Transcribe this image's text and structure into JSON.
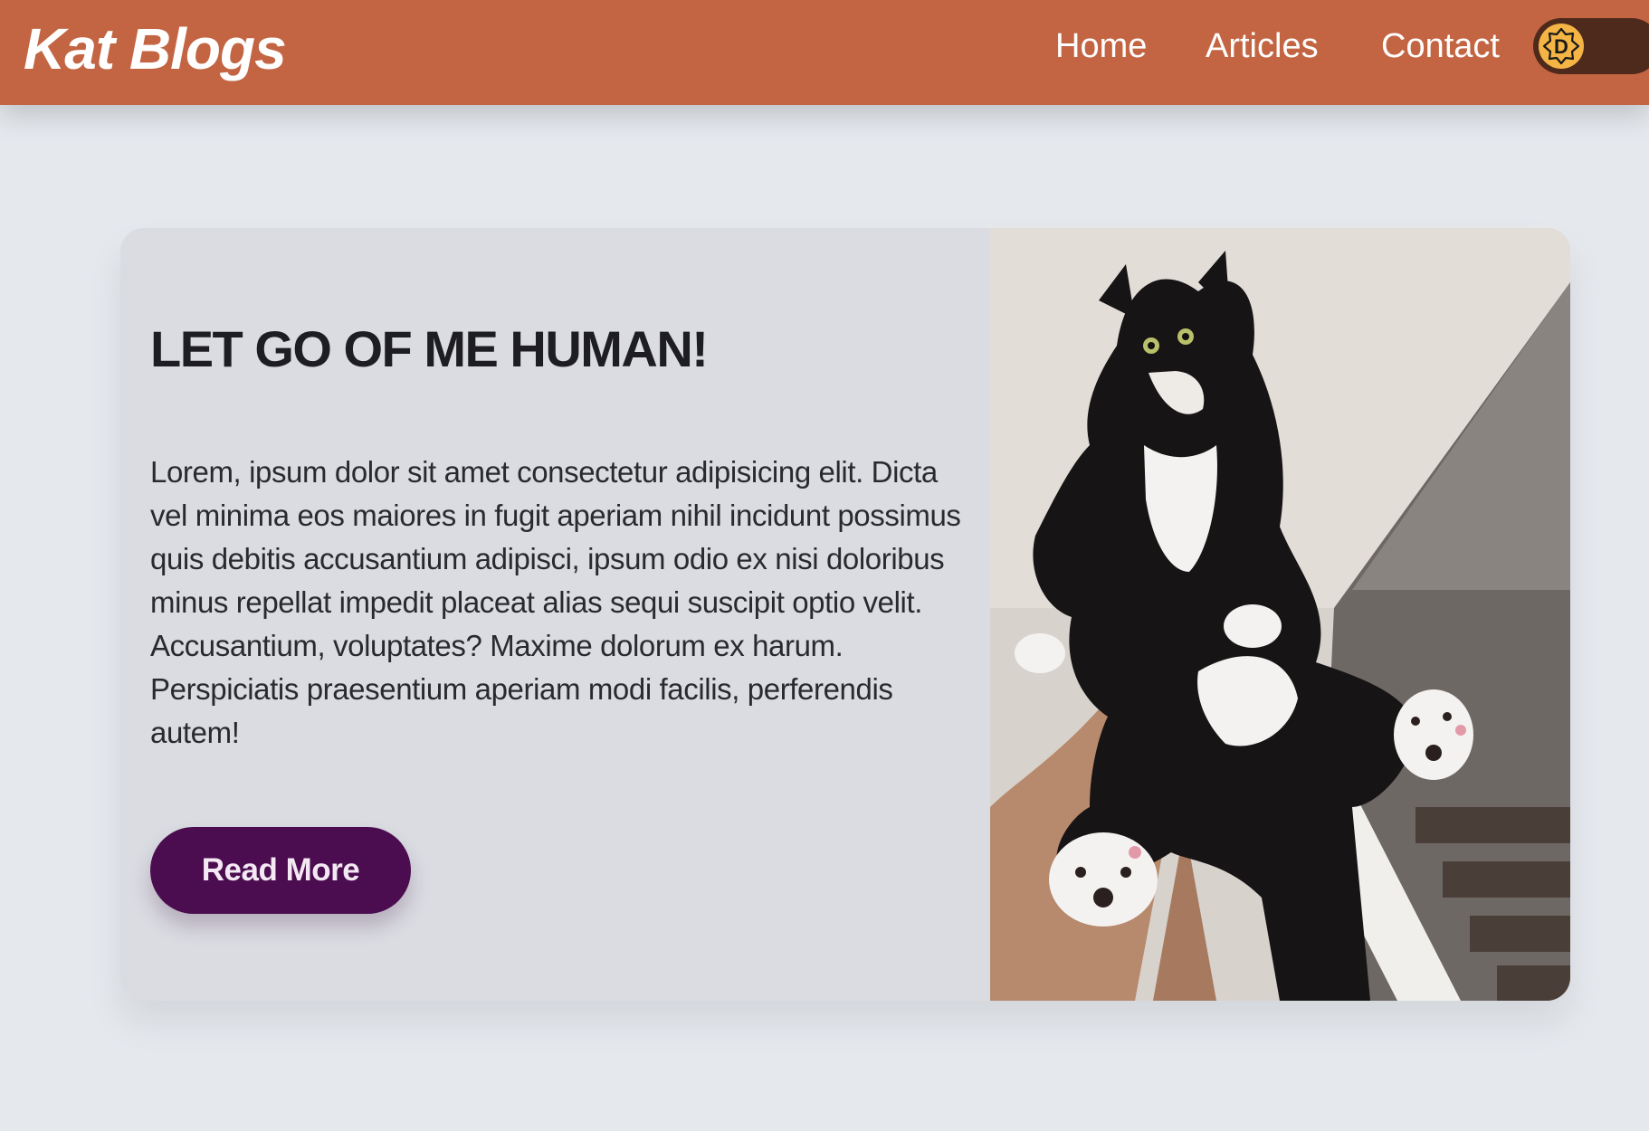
{
  "header": {
    "brand": "Kat Blogs",
    "nav": [
      {
        "label": "Home"
      },
      {
        "label": "Articles"
      },
      {
        "label": "Contact"
      }
    ],
    "theme_toggle": {
      "state": "off",
      "icon": "sun-icon",
      "knob_letter": "D"
    }
  },
  "colors": {
    "header_bg": "#c36542",
    "page_bg": "#e5e9ee",
    "card_bg": "#dadce2",
    "button_bg": "#4b0d4f",
    "toggle_track": "#4e2a1c",
    "toggle_knob": "#f4b545"
  },
  "post": {
    "title": "LET GO OF ME HUMAN!",
    "body": "Lorem, ipsum dolor sit amet consectetur adipisicing elit. Dicta vel minima eos maiores in fugit aperiam nihil incidunt possimus quis debitis accusantium adipisci, ipsum odio ex nisi doloribus minus repellat impedit placeat alias sequi suscipit optio velit. Accusantium, voluptates? Maxime dolorum ex harum. Perspiciatis praesentium aperiam modi facilis, perferendis autem!",
    "read_more": "Read More",
    "image": "cat-photo"
  }
}
